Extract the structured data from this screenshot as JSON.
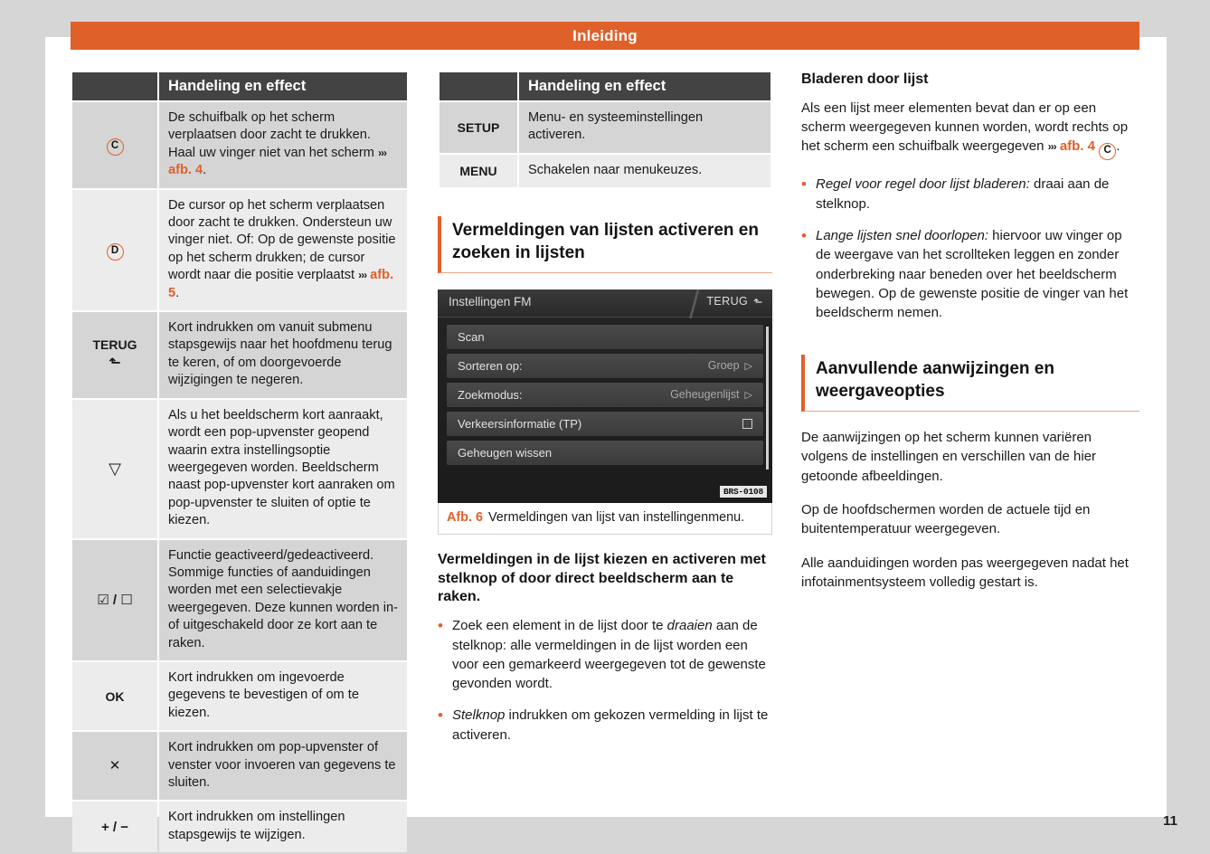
{
  "header": {
    "title": "Inleiding"
  },
  "page_number": "11",
  "colors": {
    "accent": "#e0602a",
    "header_bg": "#434343",
    "row_dark": "#d5d5d5",
    "row_light": "#ececec"
  },
  "table1": {
    "col_header_key": "",
    "col_header_value": "Handeling en effect",
    "rows": [
      {
        "key_icon": "circled-c",
        "key": "C",
        "value_pre": "De schuifbalk op het scherm verplaatsen door zacht te drukken. Haal uw vinger niet van het scherm ",
        "value_ref": "afb. 4",
        "value_post": "."
      },
      {
        "key_icon": "circled-d",
        "key": "D",
        "value_pre": "De cursor op het scherm verplaatsen door zacht te drukken. Ondersteun uw vinger niet. Of: Op de gewenste positie op het scherm drukken; de cursor wordt naar die positie verplaatst ",
        "value_ref": "afb. 5",
        "value_post": "."
      },
      {
        "key_icon": "back-arrow",
        "key": "TERUG",
        "value_pre": "Kort indrukken om vanuit submenu stapsgewijs naar het hoofdmenu terug te keren, of om doorgevoerde wijzigingen te negeren.",
        "value_ref": "",
        "value_post": ""
      },
      {
        "key_icon": "triangle-down",
        "key": "▽",
        "value_pre": "Als u het beeldscherm kort aanraakt, wordt een pop-upvenster geopend waarin extra instellingsoptie weergegeven worden. Beeldscherm naast pop-upvenster kort aanraken om pop-upvenster te sluiten of optie te kiezen.",
        "value_ref": "",
        "value_post": ""
      },
      {
        "key_icon": "checkbox-pair",
        "key": "☑ / ☐",
        "value_pre": "Functie geactiveerd/gedeactiveerd. Sommige functies of aanduidingen worden met een selectievakje weergegeven. Deze kunnen worden in- of uitgeschakeld door ze kort aan te raken.",
        "value_ref": "",
        "value_post": ""
      },
      {
        "key_icon": "ok-key",
        "key": "OK",
        "value_pre": "Kort indrukken om ingevoerde gegevens te bevestigen of om te kiezen.",
        "value_ref": "",
        "value_post": ""
      },
      {
        "key_icon": "close-key",
        "key": "✕",
        "value_pre": "Kort indrukken om pop-upvenster of venster voor invoeren van gegevens te sluiten.",
        "value_ref": "",
        "value_post": ""
      },
      {
        "key_icon": "plus-minus-key",
        "key": "+ / −",
        "value_pre": "Kort indrukken om instellingen stapsgewijs te wijzigen.",
        "value_ref": "",
        "value_post": ""
      }
    ]
  },
  "table2": {
    "col_header_key": "",
    "col_header_value": "Handeling en effect",
    "rows": [
      {
        "key": "SETUP",
        "value": "Menu- en systeeminstellingen activeren."
      },
      {
        "key": "MENU",
        "value": "Schakelen naar menukeuzes."
      }
    ]
  },
  "section_lists": {
    "heading": "Vermeldingen van lijsten activeren en zoeken in lijsten"
  },
  "figure": {
    "screen_title": "Instellingen FM",
    "back_label": "TERUG",
    "rows": [
      {
        "label": "Scan",
        "value": "",
        "control": "none"
      },
      {
        "label": "Sorteren op:",
        "value": "Groep",
        "control": "arrow"
      },
      {
        "label": "Zoekmodus:",
        "value": "Geheugenlijst",
        "control": "arrow"
      },
      {
        "label": "Verkeersinformatie (TP)",
        "value": "",
        "control": "checkbox"
      },
      {
        "label": "Geheugen wissen",
        "value": "",
        "control": "none"
      }
    ],
    "watermark": "BRS-0108",
    "caption_label": "Afb. 6",
    "caption_text": "Vermeldingen van lijst van instellingenmenu."
  },
  "middle_text": {
    "subheading": "Vermeldingen in de lijst kiezen en activeren met stelknop of door direct beeldscherm aan te raken.",
    "bullets": [
      {
        "italic_lead": "",
        "pre": "Zoek een element in de lijst door te ",
        "italic": "draaien",
        "post": " aan de stelknop: alle vermeldingen in de lijst worden een voor een gemarkeerd weergegeven tot de gewenste gevonden wordt."
      },
      {
        "italic_lead": "Stelknop",
        "pre": "",
        "italic": "",
        "post": " indrukken om gekozen vermelding in lijst te activeren."
      }
    ]
  },
  "right_col": {
    "heading1": "Bladeren door lijst",
    "para1_pre": "Als een lijst meer elementen bevat dan er op een scherm weergegeven kunnen worden, wordt rechts op het scherm een schuifbalk weergegeven ",
    "para1_ref": "afb. 4",
    "para1_circle": "C",
    "para1_post": ".",
    "bullets": [
      {
        "italic": "Regel voor regel door lijst bladeren:",
        "rest": " draai aan de stelknop."
      },
      {
        "italic": "Lange lijsten snel doorlopen:",
        "rest": " hiervoor uw vinger op de weergave van het scrollteken leggen en zonder onderbreking naar beneden over het beeldscherm bewegen. Op de gewenste positie de vinger van het beeldscherm nemen."
      }
    ],
    "section_heading": "Aanvullende aanwijzingen en weergaveopties",
    "paras": [
      "De aanwijzingen op het scherm kunnen variëren volgens de instellingen en verschillen van de hier getoonde afbeeldingen.",
      "Op de hoofdschermen worden de actuele tijd en buitentemperatuur weergegeven.",
      "Alle aanduidingen worden pas weergegeven nadat het infotainmentsysteem volledig gestart is."
    ]
  }
}
